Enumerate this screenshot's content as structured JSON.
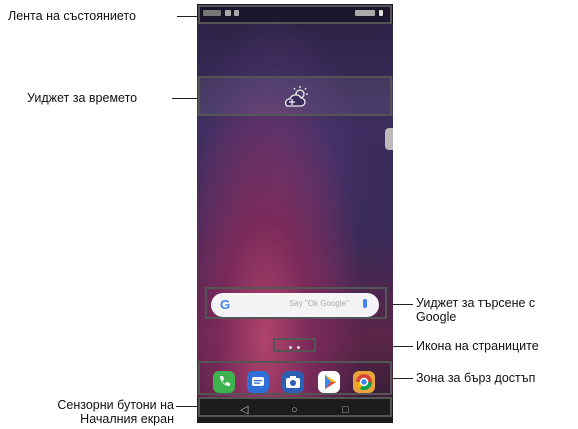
{
  "labels": {
    "status_bar": "Лента на състоянието",
    "weather_widget": "Уиджет за времето",
    "google_search_widget_line1": "Уиджет за търсене с",
    "google_search_widget_line2": "Google",
    "page_icon": "Икона на страниците",
    "quick_access": "Зона за бърз достъп",
    "home_touch_buttons_line1": "Сензорни бутони на",
    "home_touch_buttons_line2": "Началния екран"
  },
  "screen": {
    "search_logo": "G",
    "search_hint": "Say \"Ok Google\"",
    "nav_back": "◁",
    "nav_home": "○",
    "nav_recent": "□"
  },
  "icons": {
    "weather": "cloud-sun-icon",
    "apps": [
      "phone-icon",
      "messages-icon",
      "camera-icon",
      "play-store-icon",
      "chrome-icon"
    ]
  },
  "colors": {
    "phone_app": "#3fb24f",
    "messages_app": "#2f6fd6",
    "camera_app": "#2d5fb4",
    "play_store_app": "#ffffff",
    "chrome_app": "#e8a33a"
  }
}
